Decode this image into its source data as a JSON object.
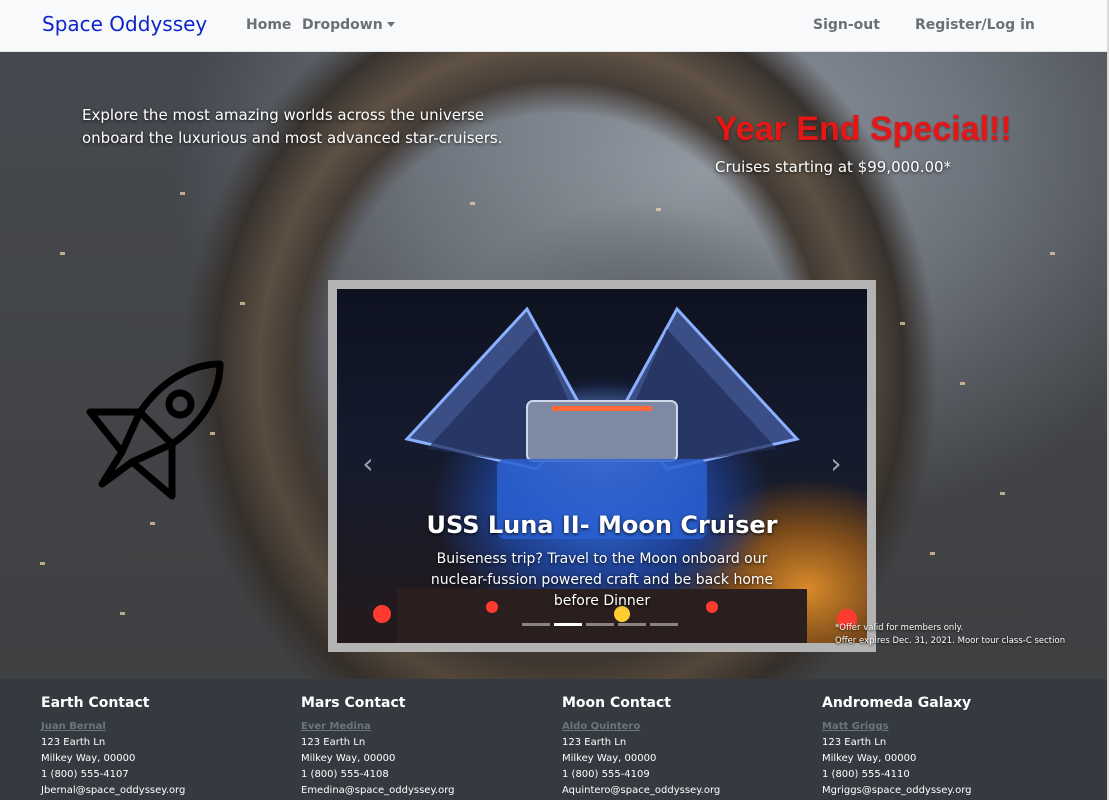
{
  "navbar": {
    "brand": "Space Oddyssey",
    "links": [
      "Home",
      "Dropdown",
      "Sign-out",
      "Register/Log in"
    ]
  },
  "hero": {
    "intro": "Explore the most amazing worlds across the universe onboard the luxurious and most advanced star-cruisers.",
    "special_title": "Year End Special!!",
    "special_subtitle": "Cruises starting at $99,000.00*",
    "offer_note_1": "*Offer valid for members only.",
    "offer_note_2": "Offer expires Dec. 31, 2021. Moor tour class-C section"
  },
  "carousel": {
    "title": "USS Luna II- Moon Cruiser",
    "description": "Buiseness trip? Travel to the Moon onboard our nuclear-fussion powered craft and be back home before Dinner",
    "prev_glyph": "‹",
    "next_glyph": "›",
    "slide_count": 5,
    "active_index": 1
  },
  "footer": {
    "contacts": [
      {
        "heading": "Earth Contact",
        "name": "Juan Bernal",
        "address": "123 Earth Ln",
        "city": "Milkey Way, 00000",
        "phone": "1 (800) 555-4107",
        "email": "Jbernal@space_oddyssey.org"
      },
      {
        "heading": "Mars Contact",
        "name": "Ever Medina",
        "address": "123 Earth Ln",
        "city": "Milkey Way, 00000",
        "phone": "1 (800) 555-4108",
        "email": "Emedina@space_oddyssey.org"
      },
      {
        "heading": "Moon Contact",
        "name": "Aldo Quintero",
        "address": "123 Earth Ln",
        "city": "Milkey Way, 00000",
        "phone": "1 (800) 555-4109",
        "email": "Aquintero@space_oddyssey.org"
      },
      {
        "heading": "Andromeda Galaxy",
        "name": "Matt Griggs",
        "address": "123 Earth Ln",
        "city": "Milkey Way, 00000",
        "phone": "1 (800) 555-4110",
        "email": "Mgriggs@space_oddyssey.org"
      }
    ]
  },
  "colors": {
    "brand": "#0d24c9",
    "special": "#e51616",
    "footer_bg": "#343a40",
    "navbar_bg": "#f8f9fa"
  },
  "icons": [
    "rocket-icon",
    "chevron-left-icon",
    "chevron-right-icon",
    "caret-down-icon"
  ]
}
